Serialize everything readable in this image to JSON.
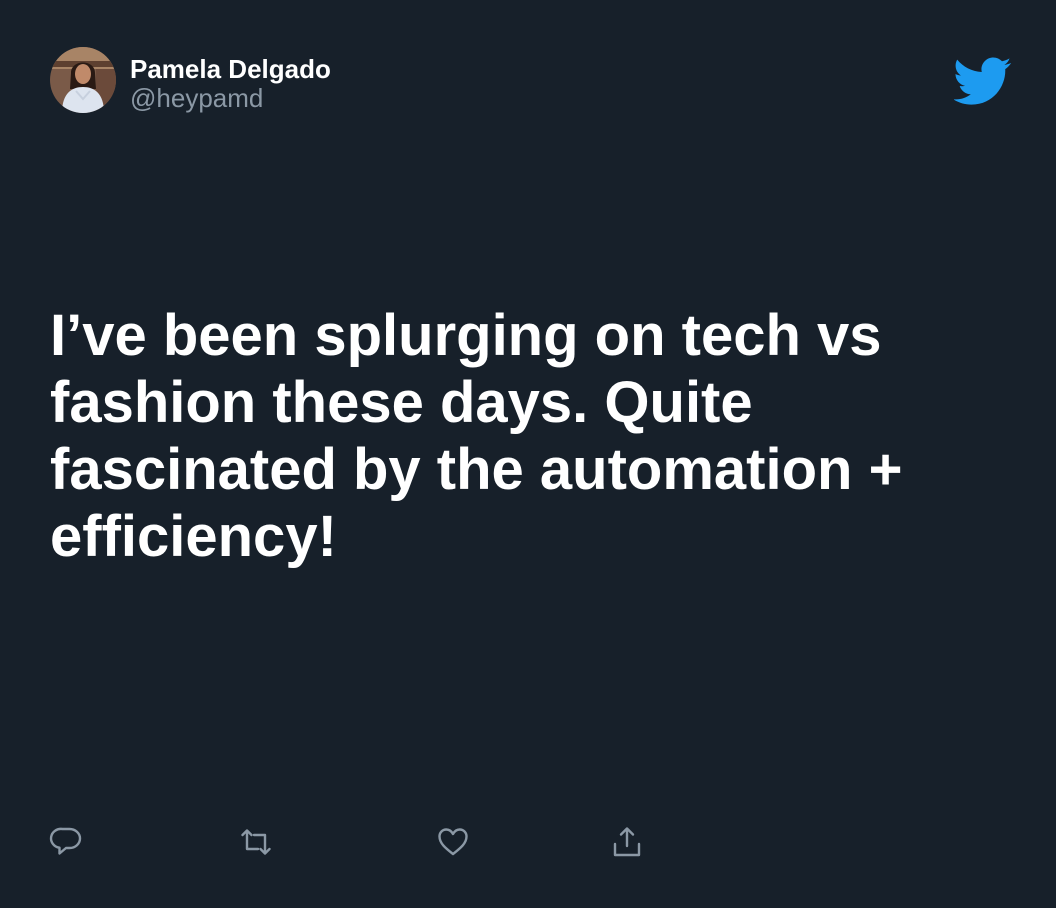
{
  "user": {
    "display_name": "Pamela Delgado",
    "handle": "@heypamd"
  },
  "tweet": {
    "text": "I’ve been splurging on tech vs fashion these days. Quite fascinated by the automation + efficiency!"
  },
  "icons": {
    "brand": "twitter-bird-icon",
    "actions": [
      "reply-icon",
      "retweet-icon",
      "like-icon",
      "share-icon"
    ]
  },
  "colors": {
    "background": "#17202a",
    "text": "#ffffff",
    "secondary_text": "#8b98a5",
    "brand_blue": "#1d9bf0",
    "icon_gray": "#8b98a5"
  }
}
